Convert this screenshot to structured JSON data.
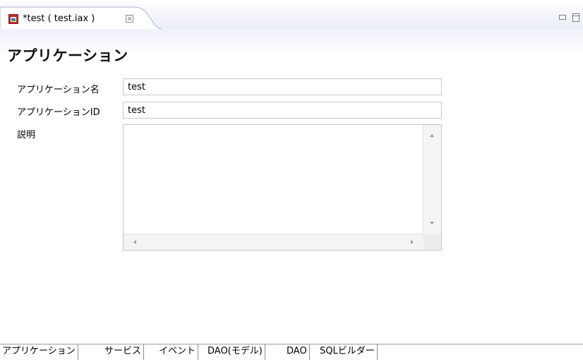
{
  "editor_tab": {
    "title": "*test ( test.iax )",
    "icon": "application-editor-icon",
    "close_icon": "close-icon"
  },
  "window_controls": {
    "minimize_icon": "minimize-icon",
    "maximize_icon": "maximize-icon"
  },
  "form": {
    "title": "アプリケーション",
    "app_name_label": "アプリケーション名",
    "app_name_value": "test",
    "app_id_label": "アプリケーションID",
    "app_id_value": "test",
    "description_label": "説明",
    "description_value": ""
  },
  "page_tabs": [
    {
      "label": "アプリケーション",
      "active": true
    },
    {
      "label": "サービス",
      "active": false
    },
    {
      "label": "イベント",
      "active": false
    },
    {
      "label": "DAO(モデル)",
      "active": false
    },
    {
      "label": "DAO",
      "active": false
    },
    {
      "label": "SQLビルダー",
      "active": false
    }
  ]
}
